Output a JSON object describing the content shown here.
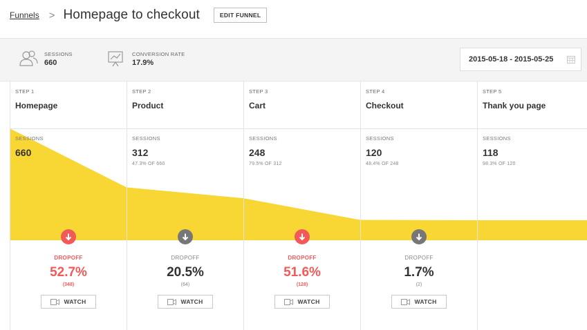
{
  "header": {
    "breadcrumb_link": "Funnels",
    "breadcrumb_sep": ">",
    "title": "Homepage to checkout",
    "edit_label": "EDIT FUNNEL"
  },
  "stats": {
    "sessions_label": "SESSIONS",
    "sessions_value": "660",
    "conversion_label": "CONVERSION RATE",
    "conversion_value": "17.9%",
    "date_range": "2015-05-18 - 2015-05-25"
  },
  "colors": {
    "funnel_fill": "#f8d633",
    "dropoff_red": "#f25a5a",
    "dropoff_gray": "#777777"
  },
  "steps": [
    {
      "step_label": "STEP 1",
      "name": "Homepage",
      "sessions_label": "SESSIONS",
      "sessions": "660",
      "pct_of": ""
    },
    {
      "step_label": "STEP 2",
      "name": "Product",
      "sessions_label": "SESSIONS",
      "sessions": "312",
      "pct_of": "47.3% OF 660"
    },
    {
      "step_label": "STEP 3",
      "name": "Cart",
      "sessions_label": "SESSIONS",
      "sessions": "248",
      "pct_of": "79.5% OF 312"
    },
    {
      "step_label": "STEP 4",
      "name": "Checkout",
      "sessions_label": "SESSIONS",
      "sessions": "120",
      "pct_of": "48.4% OF 248"
    },
    {
      "step_label": "STEP 5",
      "name": "Thank you page",
      "sessions_label": "SESSIONS",
      "sessions": "118",
      "pct_of": "98.3% OF 120"
    }
  ],
  "dropoffs": [
    {
      "label": "DROPOFF",
      "pct": "52.7%",
      "count": "(348)",
      "severity": "red",
      "icon": "arrow-down-icon",
      "watch_label": "WATCH"
    },
    {
      "label": "DROPOFF",
      "pct": "20.5%",
      "count": "(64)",
      "severity": "gray",
      "icon": "arrow-down-icon",
      "watch_label": "WATCH"
    },
    {
      "label": "DROPOFF",
      "pct": "51.6%",
      "count": "(128)",
      "severity": "red",
      "icon": "arrow-down-icon",
      "watch_label": "WATCH"
    },
    {
      "label": "DROPOFF",
      "pct": "1.7%",
      "count": "(2)",
      "severity": "gray",
      "icon": "arrow-down-icon",
      "watch_label": "WATCH"
    }
  ],
  "funnel_values": [
    660,
    312,
    248,
    120,
    118
  ]
}
